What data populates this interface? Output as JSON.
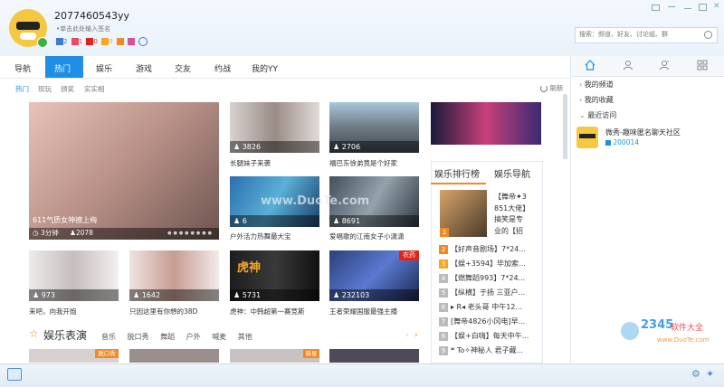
{
  "profile": {
    "username": "2077460543yy",
    "signature": "•单击此处输入签名",
    "badges": [
      "2",
      "1",
      "0",
      "0"
    ]
  },
  "search": {
    "placeholder": "搜索：频道、好友、讨论组、群"
  },
  "tabs": [
    "导航",
    "热门",
    "娱乐",
    "游戏",
    "交友",
    "约战",
    "我的YY"
  ],
  "subtabs": [
    "热门",
    "现玩",
    "颁奖",
    "实实相"
  ],
  "refresh_label": "刷新",
  "featured": {
    "title": "611气质女神撩上梅",
    "time": "3分钟",
    "viewers": "2078"
  },
  "thumbs": [
    {
      "viewers": "3826",
      "caption": "长腿妹子来袭"
    },
    {
      "viewers": "2706",
      "caption": "福巴东徐弟竟是个好家"
    },
    {
      "viewers": "6",
      "caption": "户外活力热舞最大宝"
    },
    {
      "viewers": "8691",
      "caption": "爱唱歌的江南女子小潇潇"
    },
    {
      "viewers": "973",
      "caption": "来吧，向我开炮"
    },
    {
      "viewers": "1642",
      "caption": "只因这里有你想的38D"
    },
    {
      "viewers": "5731",
      "caption": "虎神：中韩超第一赛竞斯"
    },
    {
      "viewers": "232103",
      "caption": "王者荣耀国服最强主播"
    }
  ],
  "tiger_label": "虎神",
  "game_tag": "农药",
  "ranking": {
    "tab1": "娱乐排行榜",
    "tab2": "娱乐导航",
    "top_text": [
      "【舞帝✦3",
      "851大佬】",
      "搞笑是专",
      "业的【招"
    ],
    "items": [
      {
        "n": "2",
        "text": "【好声音剧场】7*24..."
      },
      {
        "n": "3",
        "text": "【娱+3594】毕加索..."
      },
      {
        "n": "4",
        "text": "【燃舞蹈993】7*24..."
      },
      {
        "n": "5",
        "text": "【纵横】于扬 三亚户..."
      },
      {
        "n": "6",
        "text": "▸ R◂ 老头哥 中午12..."
      },
      {
        "n": "7",
        "text": "[舞帝4826小冈电]早..."
      },
      {
        "n": "8",
        "text": "【娱+白嗨】每天中午..."
      },
      {
        "n": "9",
        "text": "❝ To✧神秘人 君子藏..."
      }
    ]
  },
  "section": {
    "title": "娱乐表演",
    "tags": [
      "音乐",
      "脱口秀",
      "舞蹈",
      "户外",
      "喊麦",
      "其他"
    ],
    "badge1": "脱口秀",
    "badge2": "新星"
  },
  "sidebar": {
    "items": [
      "我的频道",
      "我的收藏",
      "最近访问"
    ],
    "recent": {
      "name": "微秀-趣味匿名聊天社区",
      "id": "200014"
    }
  },
  "watermark": {
    "brand": "2345",
    "sub": "软件大全",
    "site": "www.DuoTe.com"
  },
  "colors": {
    "accent": "#0a6cbe",
    "orange": "#f08a24",
    "red": "#e2231a"
  }
}
